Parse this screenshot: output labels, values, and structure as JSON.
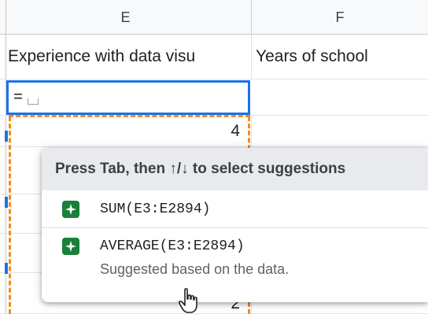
{
  "columns": {
    "e": "E",
    "f": "F"
  },
  "row1": {
    "e": "Experience with data visu",
    "f": "Years of school"
  },
  "active_cell": {
    "value": "="
  },
  "row3": {
    "e": "4"
  },
  "row_bottom": {
    "e": "2"
  },
  "popup": {
    "header": "Press Tab, then ↑/↓ to select suggestions",
    "suggestions": [
      {
        "icon": "sparkle-icon",
        "formula": "SUM(E3:E2894)"
      },
      {
        "icon": "sparkle-icon",
        "formula": "AVERAGE(E3:E2894)",
        "note": "Suggested based on the data."
      }
    ]
  },
  "colors": {
    "active": "#1a73e8",
    "range": "#f28b1d",
    "icon": "#188038"
  }
}
